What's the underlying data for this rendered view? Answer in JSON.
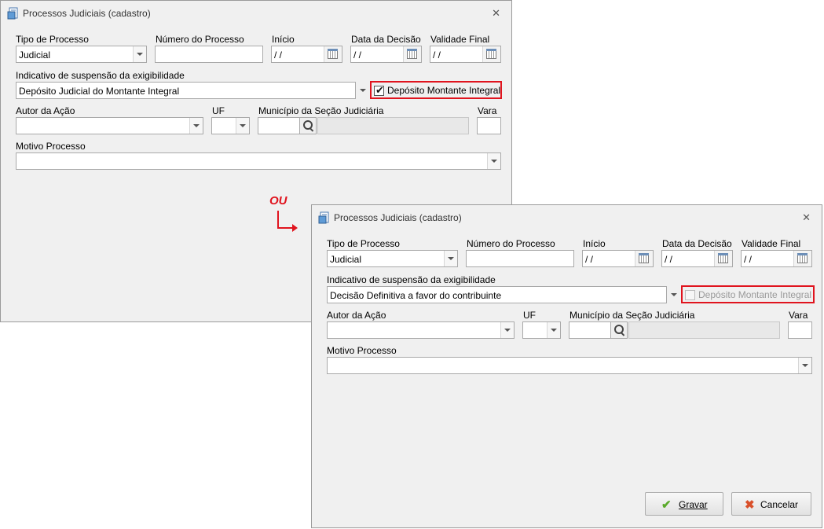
{
  "ou_label": "OU",
  "colors": {
    "highlight": "#e0141e",
    "window_bg": "#f0f0f0",
    "save_icon": "#5aaa2a",
    "cancel_icon": "#d9502a"
  },
  "window1": {
    "title": "Processos Judiciais (cadastro)",
    "labels": {
      "tipo": "Tipo de Processo",
      "numero": "Número do Processo",
      "inicio": "Início",
      "data_decisao": "Data da Decisão",
      "validade": "Validade Final",
      "indicativo": "Indicativo de suspensão da exigibilidade",
      "autor": "Autor da Ação",
      "uf": "UF",
      "municipio": "Município da Seção Judiciária",
      "vara": "Vara",
      "motivo": "Motivo Processo"
    },
    "values": {
      "tipo": "Judicial",
      "numero": "",
      "inicio": " / /",
      "data_decisao": " / /",
      "validade": " / /",
      "indicativo": "Depósito Judicial do Montante Integral",
      "autor": "",
      "uf": "",
      "municipio_code": "",
      "municipio_name": "",
      "vara": "",
      "motivo": ""
    },
    "checkbox": {
      "label": "Depósito Montante Integral",
      "checked": true,
      "enabled": true
    }
  },
  "window2": {
    "title": "Processos Judiciais (cadastro)",
    "labels": {
      "tipo": "Tipo de Processo",
      "numero": "Número do Processo",
      "inicio": "Início",
      "data_decisao": "Data da Decisão",
      "validade": "Validade Final",
      "indicativo": "Indicativo de suspensão da exigibilidade",
      "autor": "Autor da Ação",
      "uf": "UF",
      "municipio": "Município da Seção Judiciária",
      "vara": "Vara",
      "motivo": "Motivo Processo"
    },
    "values": {
      "tipo": "Judicial",
      "numero": "",
      "inicio": " / /",
      "data_decisao": " / /",
      "validade": " / /",
      "indicativo": "Decisão Definitiva a favor do contribuinte",
      "autor": "",
      "uf": "",
      "municipio_code": "",
      "municipio_name": "",
      "vara": "",
      "motivo": ""
    },
    "checkbox": {
      "label": "Depósito Montante Integral",
      "checked": false,
      "enabled": false
    },
    "buttons": {
      "save": "Gravar",
      "cancel": "Cancelar"
    }
  }
}
